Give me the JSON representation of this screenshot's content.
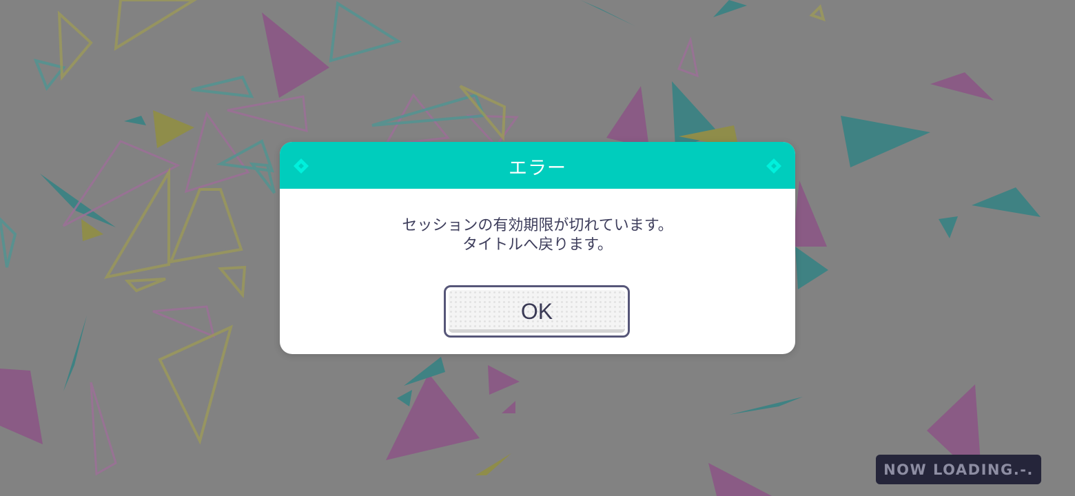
{
  "colors": {
    "background": "#828282",
    "header_accent": "#00cdbd",
    "diamond_accent": "#00f0dc",
    "text": "#3e3e5c",
    "button_border": "#565678",
    "loading_badge_bg": "#25253a",
    "loading_text": "#8d8da2",
    "shard_pink": "#8a5b85",
    "shard_teal": "#3f8283",
    "shard_yellow": "#8f8d4a"
  },
  "dialog": {
    "title": "エラー",
    "message_line1": "セッションの有効期限が切れています。",
    "message_line2": "タイトルへ戻ります。",
    "ok_label": "OK",
    "header_icons": [
      "diamond-icon",
      "diamond-icon"
    ]
  },
  "loading": {
    "text": "NOW LOADING.-."
  }
}
